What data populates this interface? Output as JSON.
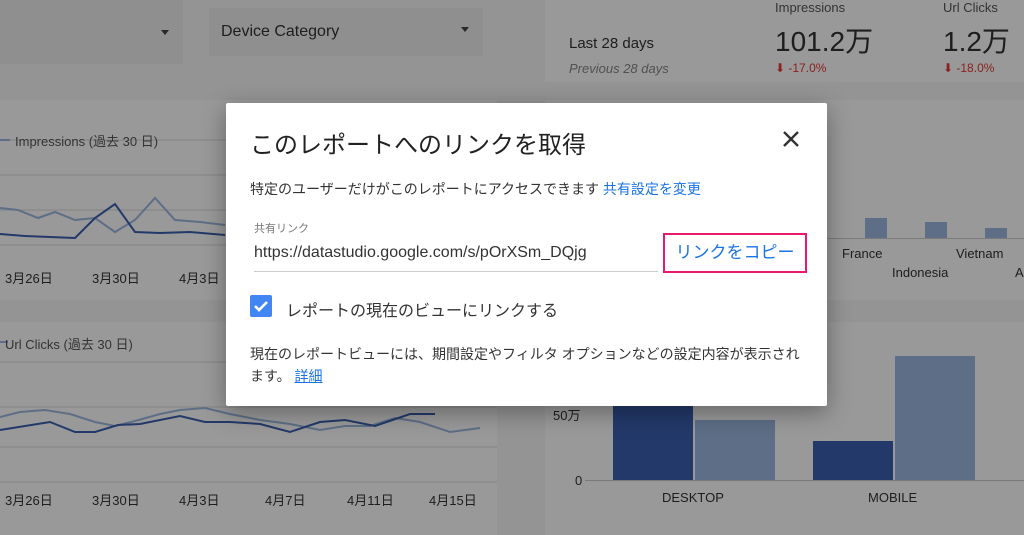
{
  "filters": {
    "device_category": "Device Category"
  },
  "scorecard": {
    "period": "Last 28 days",
    "previous": "Previous 28 days",
    "metrics": [
      {
        "label": "Impressions",
        "value": "101.2万",
        "delta": "-17.0%"
      },
      {
        "label": "Url Clicks",
        "value": "1.2万",
        "delta": "-18.0%"
      }
    ],
    "delta_color": "#e53935"
  },
  "impressions_chart": {
    "legend": "Impressions (過去 30 日)",
    "x_ticks": [
      "3月26日",
      "3月30日",
      "4月3日"
    ]
  },
  "clicks_chart": {
    "legend": "Url Clicks (過去 30 日)",
    "x_ticks": [
      "3月26日",
      "3月30日",
      "4月3日",
      "4月7日",
      "4月11日",
      "4月15日"
    ]
  },
  "country_chart": {
    "labels": [
      "France",
      "Vietnam",
      "Indonesia",
      "A"
    ]
  },
  "device_chart": {
    "y_ticks": [
      "50万",
      "0"
    ],
    "categories": [
      "DESKTOP",
      "MOBILE"
    ]
  },
  "modal": {
    "title": "このレポートへのリンクを取得",
    "description": "特定のユーザーだけがこのレポートにアクセスできます",
    "description_link": "共有設定を変更",
    "field_label": "共有リンク",
    "url": "https://datastudio.google.com/s/pOrXSm_DQjg",
    "copy_label": "リンクをコピー",
    "checkbox_label": "レポートの現在のビューにリンクする",
    "checkbox_checked": true,
    "note": "現在のレポートビューには、期間設定やフィルタ オプションなどの設定内容が表示されます。",
    "note_link": "詳細"
  },
  "colors": {
    "accent": "#1a73e8",
    "highlight_border": "#e8196e",
    "checkbox": "#4285f4",
    "series_dark": "#3b5fb0",
    "series_light": "#9bb8e0"
  }
}
